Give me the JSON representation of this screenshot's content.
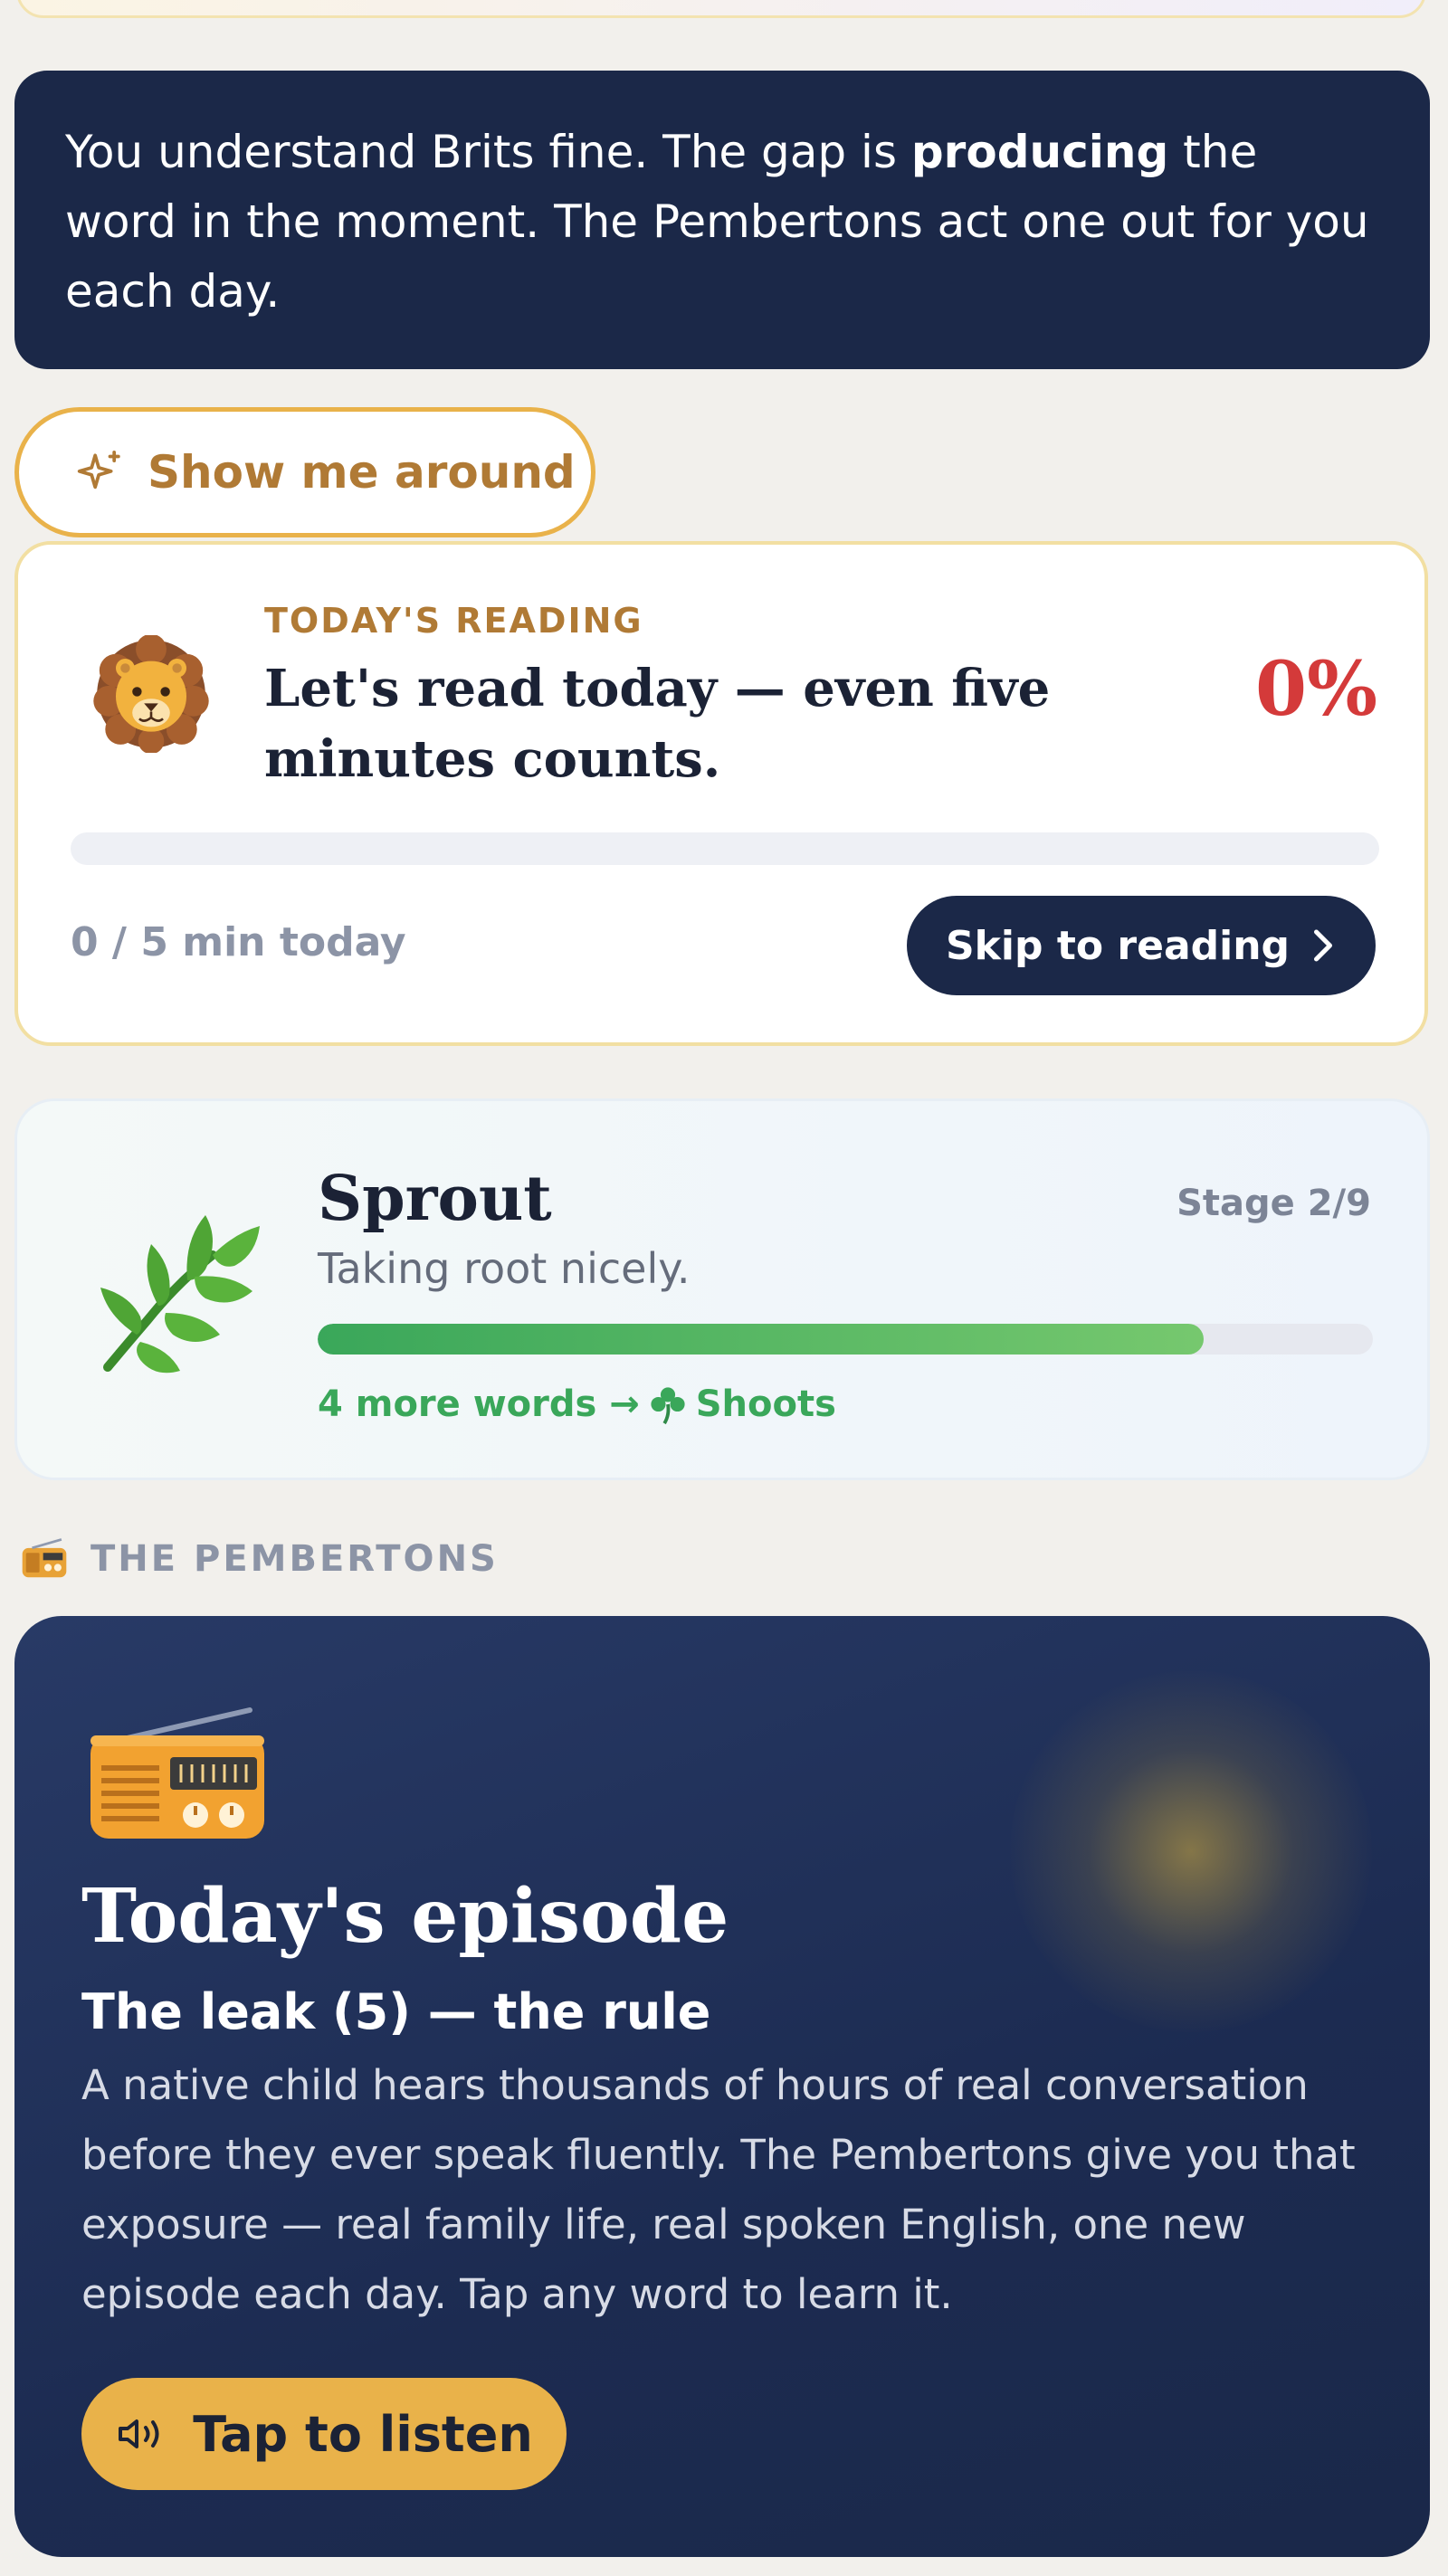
{
  "intro": {
    "text_before": "You understand Brits fine. The gap is ",
    "text_bold": "producing",
    "text_after": " the word in the moment. The Pembertons act one out for you each day."
  },
  "tour_button": {
    "label": "Show me around",
    "icon": "sparkle-icon"
  },
  "reading": {
    "icon": "lion-emoji",
    "kicker": "TODAY'S READING",
    "title": "Let's read today — even five minutes counts.",
    "percent_label": "0%",
    "progress_fraction": 0,
    "minutes_label": "0 / 5 min today",
    "skip_label": "Skip to reading",
    "skip_icon": "chevron-right-icon"
  },
  "stage": {
    "icon": "herb-emoji",
    "name": "Sprout",
    "stage_label": "Stage 2/9",
    "description": "Taking root nicely.",
    "progress_fraction": 0.84,
    "next_prefix": "4 more words →",
    "next_icon": "shamrock-emoji",
    "next_name": "Shoots"
  },
  "section": {
    "icon": "radio-emoji",
    "label": "THE PEMBERTONS"
  },
  "episode": {
    "icon": "radio-emoji",
    "title": "Today's episode",
    "subtitle": "The leak (5) — the rule",
    "body": "A native child hears thousands of hours of real conversation before they ever speak fluently. The Pembertons give you that exposure — real family life, real spoken English, one new episode each day. Tap any word to learn it.",
    "listen_label": "Tap to listen",
    "listen_icon": "speaker-icon"
  },
  "colors": {
    "navy": "#1b2848",
    "gold": "#e9b24a",
    "gold_text": "#b07a35",
    "red_percent": "#d43a3a",
    "green": "#3aa75a",
    "muted": "#8c94a6",
    "page_bg": "#f2f0ec"
  }
}
